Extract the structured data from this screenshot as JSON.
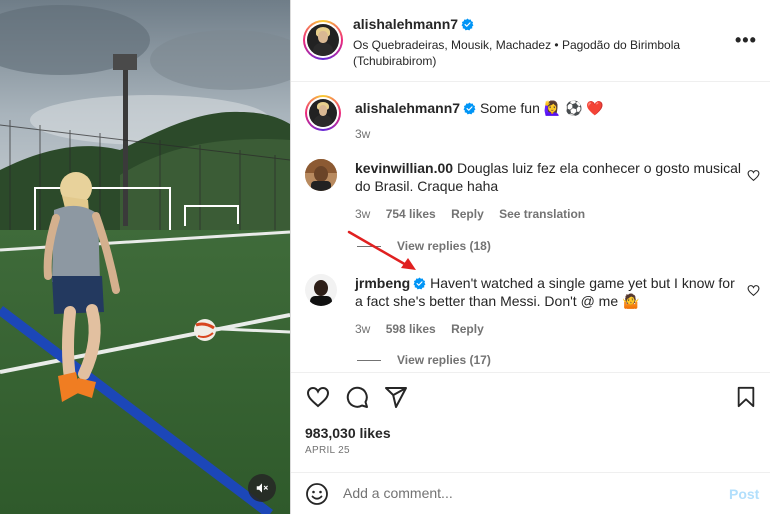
{
  "post": {
    "username": "alishalehmann7",
    "audio": "Os Quebradeiras, Mousik, Machadez • Pagodão do Birimbola (Tchubirabirom)",
    "more_label": "•••"
  },
  "caption": {
    "username": "alishalehmann7",
    "text": "Some fun",
    "emojis": "🙋‍♀️ ⚽ ❤️",
    "time": "3w"
  },
  "comments": [
    {
      "username": "kevinwillian.00",
      "text": "Douglas luiz fez ela conhecer o gosto musical do Brasil. Craque haha",
      "time": "3w",
      "likes": "754 likes",
      "reply_label": "Reply",
      "translate_label": "See translation",
      "view_replies": "View replies (18)"
    },
    {
      "username": "jrmbeng",
      "text": "Haven't watched a single game yet but I know for a fact she's better than Messi. Don't @ me 🤷",
      "time": "3w",
      "likes": "598 likes",
      "reply_label": "Reply",
      "view_replies": "View replies (17)"
    }
  ],
  "stats": {
    "likes": "983,030 likes",
    "date": "APRIL 25"
  },
  "composer": {
    "placeholder": "Add a comment...",
    "post_label": "Post"
  },
  "colors": {
    "verified": "#0095f6",
    "annotation_arrow": "#e02020",
    "heart_emoji": "#ed4956"
  }
}
